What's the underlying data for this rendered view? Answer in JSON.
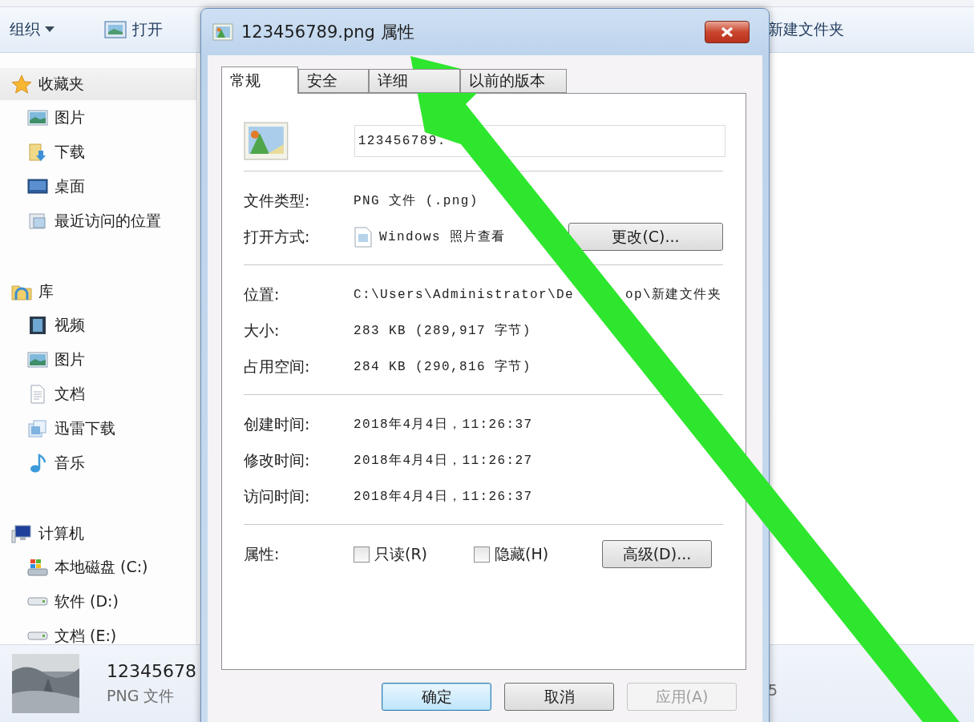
{
  "explorer": {
    "toolbar": [
      {
        "label": "组织",
        "kind": "menu"
      },
      {
        "label": "打开",
        "kind": "open"
      },
      {
        "label": "新建文件夹",
        "kind": "plain"
      }
    ],
    "sidebar": [
      {
        "label": "收藏夹",
        "kind": "star",
        "selected": true,
        "children": [
          {
            "label": "图片",
            "kind": "pictures"
          },
          {
            "label": "下载",
            "kind": "downloads"
          },
          {
            "label": "桌面",
            "kind": "desktop"
          },
          {
            "label": "最近访问的位置",
            "kind": "recent"
          }
        ]
      },
      {
        "label": "库",
        "kind": "library",
        "selected": false,
        "children": [
          {
            "label": "视频",
            "kind": "video"
          },
          {
            "label": "图片",
            "kind": "pictures"
          },
          {
            "label": "文档",
            "kind": "document"
          },
          {
            "label": "迅雷下载",
            "kind": "downloads2"
          },
          {
            "label": "音乐",
            "kind": "music"
          }
        ]
      },
      {
        "label": "计算机",
        "kind": "computer",
        "selected": false,
        "children": [
          {
            "label": "本地磁盘 (C:)",
            "kind": "system-drive"
          },
          {
            "label": "软件 (D:)",
            "kind": "drive"
          },
          {
            "label": "文档 (E:)",
            "kind": "drive"
          }
        ]
      }
    ],
    "details": {
      "name": "12345678",
      "type": "PNG 文件",
      "extra": "5"
    }
  },
  "dialog": {
    "title": "123456789.png 属性",
    "tabs": [
      {
        "label": "常规",
        "selected": true
      },
      {
        "label": "安全",
        "selected": false
      },
      {
        "label": "详细",
        "selected": false
      },
      {
        "label": "以前的版本",
        "selected": false
      }
    ],
    "filename": "123456789.",
    "sections": [
      [
        {
          "label": "文件类型:",
          "parts": [
            "PNG 文件 (.png)"
          ],
          "kind": "text"
        },
        {
          "label": "打开方式:",
          "parts": [
            "Windows 照片查看"
          ],
          "kind": "app",
          "button": "更改(C)..."
        }
      ],
      [
        {
          "label": "位置:",
          "parts": [
            "C:\\Users\\Administrator\\De",
            "op\\新建文件夹"
          ],
          "kind": "text"
        },
        {
          "label": "大小:",
          "parts": [
            "283 KB (289,917 字节)"
          ],
          "kind": "text"
        },
        {
          "label": "占用空间:",
          "parts": [
            "284 KB (290,816 字节)"
          ],
          "kind": "text"
        }
      ],
      [
        {
          "label": "创建时间:",
          "parts": [
            "2018年4月4日，11:26:37"
          ],
          "kind": "text"
        },
        {
          "label": "修改时间:",
          "parts": [
            "2018年4月4日，11:26:27"
          ],
          "kind": "text"
        },
        {
          "label": "访问时间:",
          "parts": [
            "2018年4月4日，11:26:37"
          ],
          "kind": "text"
        }
      ]
    ],
    "attributes": {
      "label": "属性:",
      "checkboxes": [
        {
          "label": "只读(R)",
          "checked": false
        },
        {
          "label": "隐藏(H)",
          "checked": false
        }
      ],
      "button": "高级(D)..."
    },
    "buttons": [
      {
        "label": "确定",
        "default": true,
        "disabled": false
      },
      {
        "label": "取消",
        "default": false,
        "disabled": false
      },
      {
        "label": "应用(A)",
        "default": false,
        "disabled": true
      }
    ]
  }
}
